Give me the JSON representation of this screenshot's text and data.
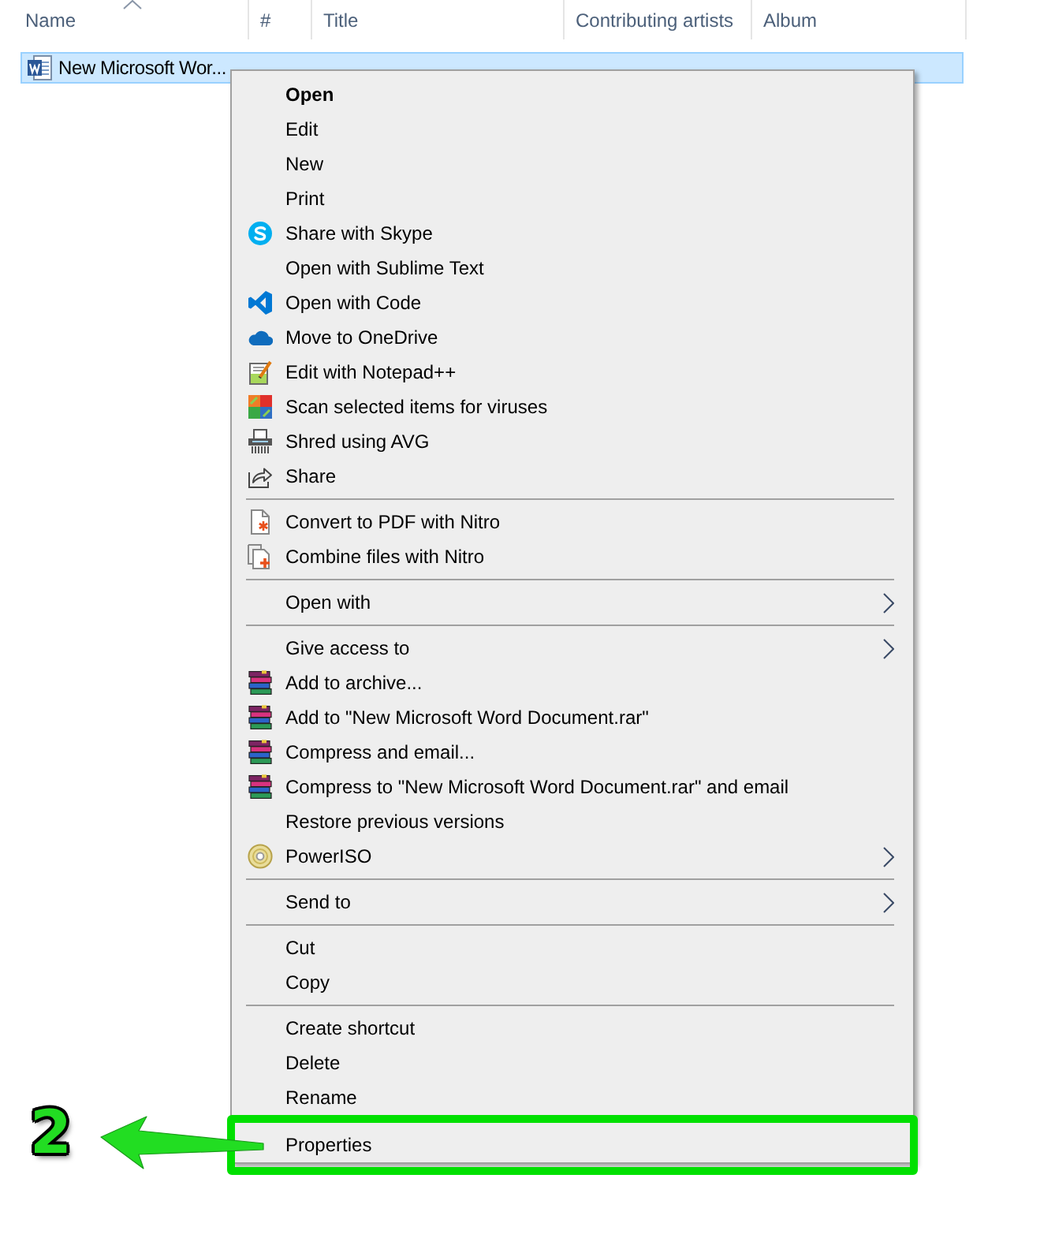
{
  "columns": [
    {
      "label": "Name",
      "sorted": true
    },
    {
      "label": "#",
      "sorted": false
    },
    {
      "label": "Title",
      "sorted": false
    },
    {
      "label": "Contributing artists",
      "sorted": false
    },
    {
      "label": "Album",
      "sorted": false
    }
  ],
  "files": [
    {
      "name": "New Microsoft Wor...",
      "selected": true
    }
  ],
  "context_menu": {
    "sections": [
      {
        "items": [
          {
            "label": "Open",
            "default": true,
            "submenu": false,
            "marked": false
          },
          {
            "label": "Edit",
            "default": false,
            "submenu": false,
            "marked": false
          },
          {
            "label": "New",
            "default": false,
            "submenu": false,
            "marked": false
          },
          {
            "label": "Print",
            "default": false,
            "submenu": false,
            "marked": false
          },
          {
            "label": "Share with Skype",
            "default": false,
            "submenu": false,
            "marked": false
          },
          {
            "label": "Open with Sublime Text",
            "default": false,
            "submenu": false,
            "marked": false
          },
          {
            "label": "Open with Code",
            "default": false,
            "submenu": false,
            "marked": false
          },
          {
            "label": "Move to OneDrive",
            "default": false,
            "submenu": false,
            "marked": false
          },
          {
            "label": "Edit with Notepad++",
            "default": false,
            "submenu": false,
            "marked": false
          },
          {
            "label": "Scan selected items for viruses",
            "default": false,
            "submenu": false,
            "marked": false
          },
          {
            "label": "Shred using AVG",
            "default": false,
            "submenu": false,
            "marked": false
          },
          {
            "label": "Share",
            "default": false,
            "submenu": false,
            "marked": false
          }
        ]
      },
      {
        "items": [
          {
            "label": "Convert to PDF with Nitro",
            "default": false,
            "submenu": false,
            "marked": false
          },
          {
            "label": "Combine files with Nitro",
            "default": false,
            "submenu": false,
            "marked": false
          }
        ]
      },
      {
        "items": [
          {
            "label": "Open with",
            "default": false,
            "submenu": true,
            "marked": false
          }
        ]
      },
      {
        "items": [
          {
            "label": "Give access to",
            "default": false,
            "submenu": true,
            "marked": false
          },
          {
            "label": "Add to archive...",
            "default": false,
            "submenu": false,
            "marked": false
          },
          {
            "label": "Add to \"New Microsoft Word Document.rar\"",
            "default": false,
            "submenu": false,
            "marked": false
          },
          {
            "label": "Compress and email...",
            "default": false,
            "submenu": false,
            "marked": false
          },
          {
            "label": "Compress to \"New Microsoft Word Document.rar\" and email",
            "default": false,
            "submenu": false,
            "marked": false
          },
          {
            "label": "Restore previous versions",
            "default": false,
            "submenu": false,
            "marked": false
          },
          {
            "label": "PowerISO",
            "default": false,
            "submenu": true,
            "marked": false
          }
        ]
      },
      {
        "items": [
          {
            "label": "Send to",
            "default": false,
            "submenu": true,
            "marked": false
          }
        ]
      },
      {
        "items": [
          {
            "label": "Cut",
            "default": false,
            "submenu": false,
            "marked": false
          },
          {
            "label": "Copy",
            "default": false,
            "submenu": false,
            "marked": false
          }
        ]
      },
      {
        "items": [
          {
            "label": "Create shortcut",
            "default": false,
            "submenu": false,
            "marked": false
          },
          {
            "label": "Delete",
            "default": false,
            "submenu": false,
            "marked": false
          },
          {
            "label": "Rename",
            "default": false,
            "submenu": false,
            "marked": false
          },
          {
            "label": "Properties",
            "default": false,
            "submenu": false,
            "marked": true
          }
        ]
      }
    ]
  },
  "annotation": {
    "label": "2"
  }
}
